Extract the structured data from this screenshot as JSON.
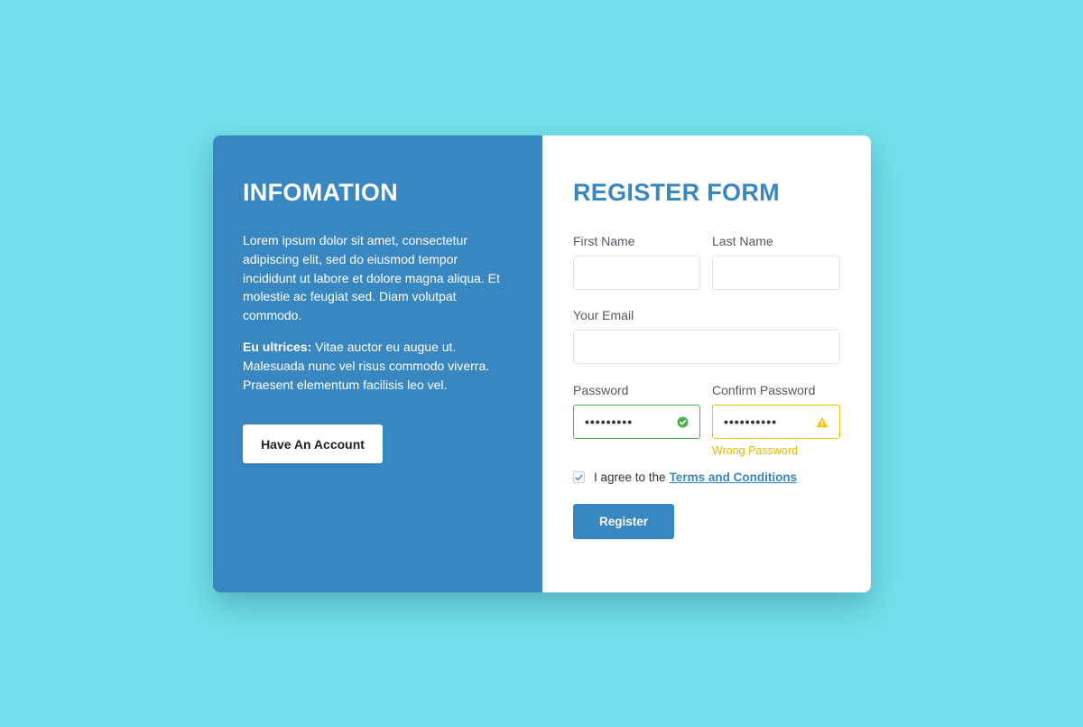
{
  "colors": {
    "background": "#72e0ea",
    "primary": "#3887c0",
    "success": "#4caf50",
    "warning": "#f1c40f",
    "warning_text": "#e6b800"
  },
  "info": {
    "title": "INFOMATION",
    "paragraph1": "Lorem ipsum dolor sit amet, consectetur adipiscing elit, sed do eiusmod tempor incididunt ut labore et dolore magna aliqua. Et molestie ac feugiat sed. Diam volutpat commodo.",
    "paragraph2_bold": "Eu ultrices:",
    "paragraph2_rest": " Vitae auctor eu augue ut. Malesuada nunc vel risus commodo viverra. Praesent elementum facilisis leo vel.",
    "have_account_label": "Have An Account"
  },
  "form": {
    "title": "REGISTER FORM",
    "first_name": {
      "label": "First Name",
      "value": ""
    },
    "last_name": {
      "label": "Last Name",
      "value": ""
    },
    "email": {
      "label": "Your Email",
      "value": ""
    },
    "password": {
      "label": "Password",
      "value": "•••••••••",
      "status_icon": "check-circle-icon"
    },
    "confirm_password": {
      "label": "Confirm Password",
      "value": "••••••••••",
      "status_icon": "warning-triangle-icon",
      "error": "Wrong Password"
    },
    "agree_checked": true,
    "agree_prefix": "I agree to the",
    "terms_link": "Terms and Conditions",
    "register_label": "Register"
  }
}
